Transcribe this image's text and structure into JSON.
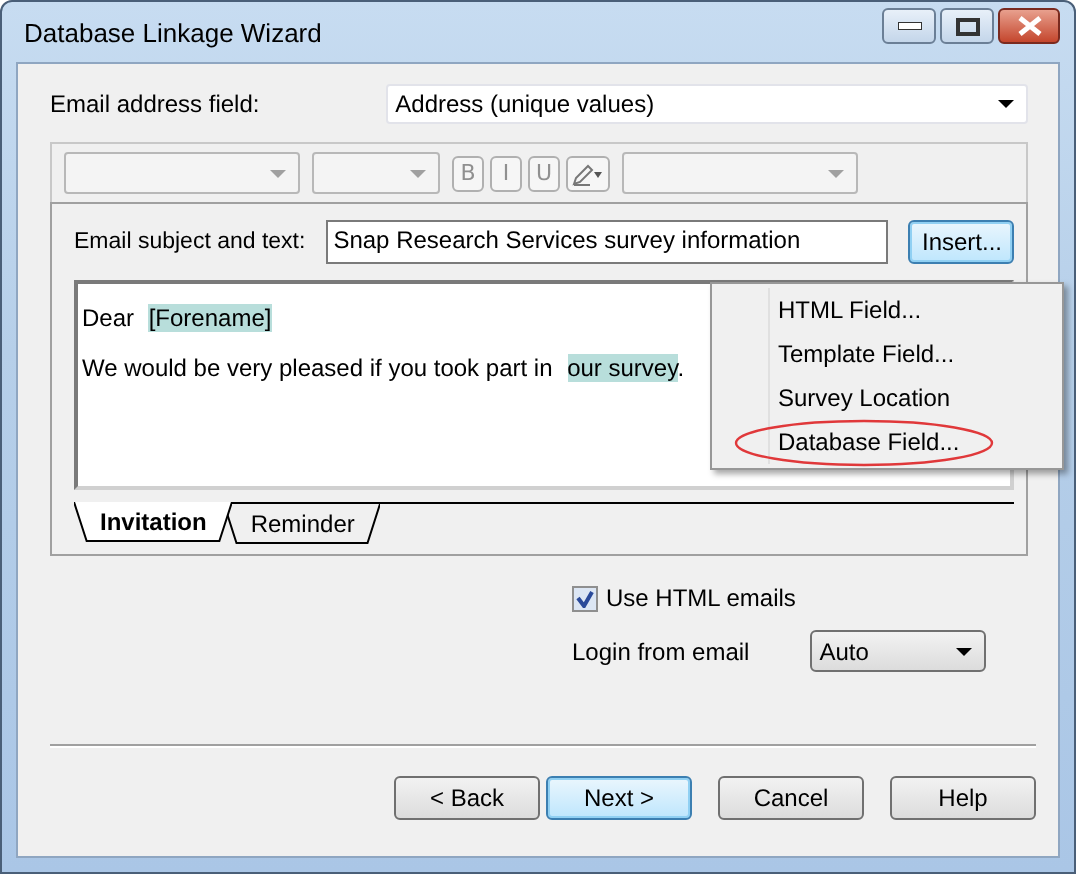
{
  "window": {
    "title": "Database Linkage Wizard"
  },
  "email_address_field": {
    "label": "Email address field:",
    "value": "Address (unique values)"
  },
  "format_toolbar": {
    "disabled": true,
    "style_buttons": [
      "B",
      "I",
      "U"
    ]
  },
  "subject": {
    "label": "Email subject and text:",
    "value": "Snap Research Services survey information",
    "insert_button": "Insert..."
  },
  "body": [
    [
      {
        "kind": "text",
        "text": "Dear "
      },
      {
        "kind": "field",
        "text": "[Forename]"
      }
    ],
    [
      {
        "kind": "text",
        "text": "We would be very pleased if you took part in "
      },
      {
        "kind": "field",
        "text": "our survey"
      },
      {
        "kind": "text",
        "text": "."
      }
    ]
  ],
  "tabs": [
    {
      "label": "Invitation",
      "selected": true
    },
    {
      "label": "Reminder",
      "selected": false
    }
  ],
  "insert_menu": [
    {
      "label": "HTML Field...",
      "circled": false
    },
    {
      "label": "Template Field...",
      "circled": false
    },
    {
      "label": "Survey Location",
      "circled": false
    },
    {
      "label": "Database Field...",
      "circled": true
    }
  ],
  "use_html_emails": {
    "label": "Use HTML emails",
    "checked": true
  },
  "login_from_email": {
    "label": "Login from email",
    "value": "Auto"
  },
  "buttons": [
    {
      "label": "< Back",
      "default": false
    },
    {
      "label": "Next >",
      "default": true
    },
    {
      "label": "Cancel",
      "default": false
    },
    {
      "label": "Help",
      "default": false
    }
  ]
}
